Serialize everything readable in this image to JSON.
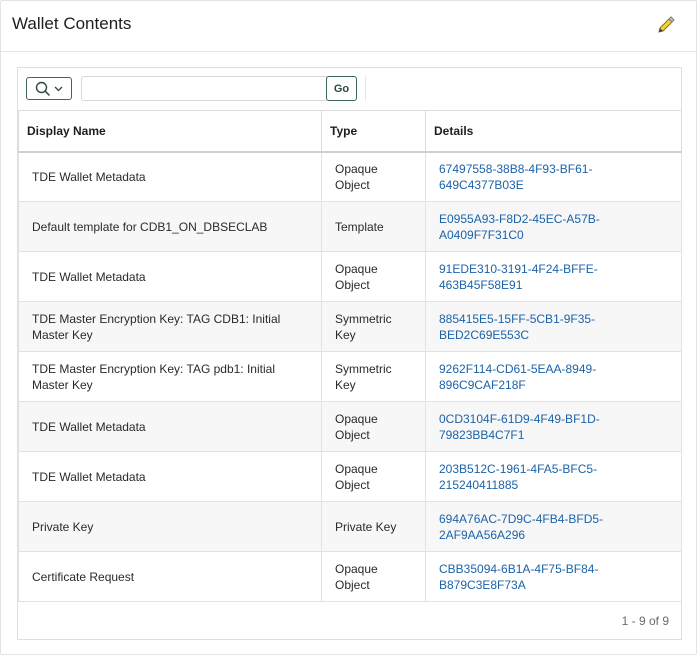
{
  "header": {
    "title": "Wallet Contents",
    "edit_icon": "pencil-icon"
  },
  "toolbar": {
    "search_icon": "search-icon",
    "go_label": "Go",
    "search_value": ""
  },
  "table": {
    "columns": [
      "Display Name",
      "Type",
      "Details"
    ],
    "rows": [
      {
        "name": "TDE Wallet Metadata",
        "type": "Opaque Object",
        "details": "67497558-38B8-4F93-BF61-649C4377B03E"
      },
      {
        "name": "Default template for CDB1_ON_DBSECLAB",
        "type": "Template",
        "details": "E0955A93-F8D2-45EC-A57B-A0409F7F31C0"
      },
      {
        "name": "TDE Wallet Metadata",
        "type": "Opaque Object",
        "details": "91EDE310-3191-4F24-BFFE-463B45F58E91"
      },
      {
        "name": "TDE Master Encryption Key: TAG CDB1: Initial Master Key",
        "type": "Symmetric Key",
        "details": "885415E5-15FF-5CB1-9F35-BED2C69E553C"
      },
      {
        "name": "TDE Master Encryption Key: TAG pdb1: Initial Master Key",
        "type": "Symmetric Key",
        "details": "9262F114-CD61-5EAA-8949-896C9CAF218F"
      },
      {
        "name": "TDE Wallet Metadata",
        "type": "Opaque Object",
        "details": "0CD3104F-61D9-4F49-BF1D-79823BB4C7F1"
      },
      {
        "name": "TDE Wallet Metadata",
        "type": "Opaque Object",
        "details": "203B512C-1961-4FA5-BFC5-215240411885"
      },
      {
        "name": "Private Key",
        "type": "Private Key",
        "details": "694A76AC-7D9C-4FB4-BFD5-2AF9AA56A296"
      },
      {
        "name": "Certificate Request",
        "type": "Opaque Object",
        "details": "CBB35094-6B1A-4F75-BF84-B879C3E8F73A"
      }
    ]
  },
  "pagination": {
    "text": "1 - 9 of 9"
  }
}
